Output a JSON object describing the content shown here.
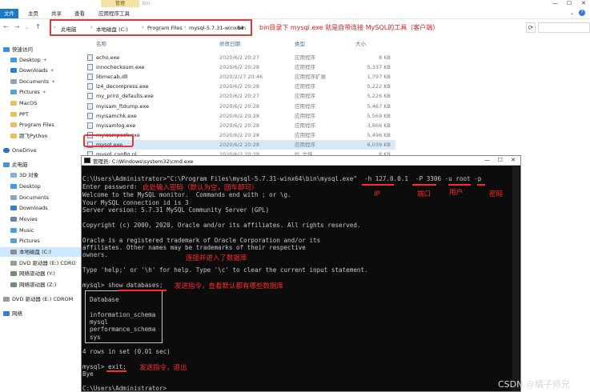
{
  "explorer": {
    "manage_tab": "管理",
    "window_name": "bin",
    "ribbon_tabs": [
      "文件",
      "主页",
      "共享",
      "查看",
      "应用程序工具"
    ],
    "address": [
      "此电脑",
      "本地磁盘 (C:)",
      "Program Files",
      "mysql-5.7.31-winx64",
      "bin"
    ],
    "address_annotation": "bin目录下 mysql.exe 就是自带连接 MySQL的工具（客户端）",
    "columns": [
      "名称",
      "修改日期",
      "类型",
      "大小"
    ],
    "files": [
      {
        "name": "echo.exe",
        "date": "2020/6/2 20:27",
        "type": "应用程序",
        "size": "8 KB"
      },
      {
        "name": "innochecksum.exe",
        "date": "2020/6/2 20:28",
        "type": "应用程序",
        "size": "5,337 KB"
      },
      {
        "name": "libmecab.dll",
        "date": "2020/2/27 20:46",
        "type": "应用程序扩展",
        "size": "1,797 KB"
      },
      {
        "name": "lz4_decompress.exe",
        "date": "2020/6/2 20:28",
        "type": "应用程序",
        "size": "5,222 KB"
      },
      {
        "name": "my_print_defaults.exe",
        "date": "2020/6/2 20:27",
        "type": "应用程序",
        "size": "5,226 KB"
      },
      {
        "name": "myisam_ftdump.exe",
        "date": "2020/6/2 20:28",
        "type": "应用程序",
        "size": "5,467 KB"
      },
      {
        "name": "myisamchk.exe",
        "date": "2020/6/2 20:28",
        "type": "应用程序",
        "size": "5,569 KB"
      },
      {
        "name": "myisamlog.exe",
        "date": "2020/6/2 20:28",
        "type": "应用程序",
        "size": "3,666 KB"
      },
      {
        "name": "myisampack.exe",
        "date": "2020/6/2 20:28",
        "type": "应用程序",
        "size": "5,496 KB"
      },
      {
        "name": "mysql.exe",
        "date": "2020/6/2 20:28",
        "type": "应用程序",
        "size": "6,039 KB"
      },
      {
        "name": "mysql_config.pl",
        "date": "2020/6/2 20:28",
        "type": "PL 文件",
        "size": "8 KB"
      }
    ],
    "nav": {
      "quick_access": "快速访问",
      "quick_items": [
        "Desktop",
        "Downloads",
        "Documents",
        "Pictures",
        "MacOS",
        "PPT",
        "Program Files",
        "跟飞Python"
      ],
      "onedrive": "OneDrive",
      "this_pc": "此电脑",
      "pc_items": [
        "3D 对象",
        "Desktop",
        "Documents",
        "Downloads",
        "Movies",
        "Music",
        "Pictures",
        "本地磁盘 (C:)",
        "DVD 驱动器 (E:) CDRO",
        "网络驱动器 (Y:)",
        "网络驱动器 (Z:)",
        "DVD 驱动器 (E:) CDROM",
        "网络"
      ]
    }
  },
  "cmd": {
    "title": "管理员: C:\\Windows\\system32\\cmd.exe",
    "lines": {
      "l1": "C:\\Users\\Administrator>\"C:\\Program Files\\mysql-5.7.31-winx64\\bin\\mysql.exe\"  -h 127.0.0.1  -P 3306 -u root -p",
      "l2": "Enter password:",
      "l3": "Welcome to the MySQL monitor.  Commands end with ; or \\g.",
      "l4": "Your MySQL connection id is 3",
      "l5": "Server version: 5.7.31 MySQL Community Server (GPL)",
      "l6": "Copyright (c) 2000, 2020, Oracle and/or its affiliates. All rights reserved.",
      "l7": "Oracle is a registered trademark of Oracle Corporation and/or its",
      "l8": "affiliates. Other names may be trademarks of their respective",
      "l9": "owners.",
      "l10": "Type 'help;' or '\\h' for help. Type '\\c' to clear the current input statement.",
      "l11": "mysql> show databases;",
      "l12": "Database",
      "l13": "information_schema",
      "l14": "mysql",
      "l15": "performance_schema",
      "l16": "sys",
      "l17": "4 rows in set (0.01 sec)",
      "l18": "mysql> exit;",
      "l19": "Bye",
      "l20": "C:\\Users\\Administrator>"
    },
    "annotations": {
      "password": "此处输入密码（默认为空，回车即可）",
      "ip": "IP",
      "port": "端口",
      "user": "用户",
      "pwd": "密码",
      "connected": "连接并进入了数据库",
      "show_db": "发送指令，查看默认都有哪些数据库",
      "exit": "发送指令，退出"
    }
  },
  "watermark": "CSDN @橘子师兄",
  "colors": {
    "annotation": "#ff2a2a",
    "highlight_border": "#e53935",
    "ribbon_active": "#1979ca"
  }
}
